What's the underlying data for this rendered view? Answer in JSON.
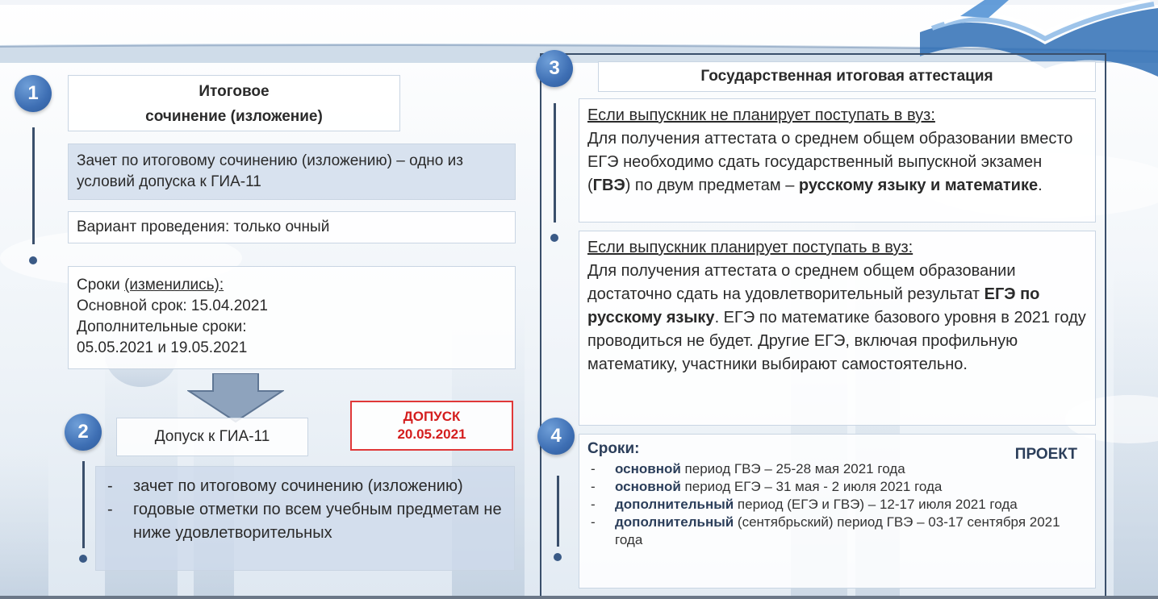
{
  "s1": {
    "num": "1",
    "title_l1": "Итоговое",
    "title_l2": "сочинение (изложение)",
    "zachet": "Зачет по итоговому сочинению (изложению) – одно из условий допуска к ГИА-11",
    "variant": "Вариант проведения: только очный",
    "sroki_label": "Сроки ",
    "sroki_changed": "(изменились):",
    "osnovnoy": "Основной срок: 15.04.2021",
    "dop_label": "Дополнительные сроки:",
    "dop_dates": "05.05.2021 и 19.05.2021"
  },
  "s2": {
    "num": "2",
    "title": "Допуск к ГИА-11",
    "dopusk_l1": "ДОПУСК",
    "dopusk_l2": "20.05.2021",
    "items": [
      "зачет по итоговому сочинению (изложению)",
      "годовые отметки по всем учебным предметам не ниже удовлетворительных"
    ]
  },
  "s3": {
    "num": "3",
    "title": "Государственная итоговая аттестация",
    "a_head": "Если выпускник не планирует поступать в вуз:",
    "a_t1": "Для получения аттестата о среднем общем образовании вместо ЕГЭ необходимо сдать государственный выпускной экзамен (",
    "a_b1": "ГВЭ",
    "a_t2": ") по двум предметам – ",
    "a_b2": "русскому языку и математике",
    "a_t3": ".",
    "b_head": "Если выпускник планирует поступать в вуз:",
    "b_t1": "Для получения аттестата о среднем общем образовании достаточно сдать на удовлетворительный результат ",
    "b_b1": "ЕГЭ по русскому языку",
    "b_t2": ". ЕГЭ по математике базового уровня в 2021 году проводиться не будет. Другие ЕГЭ, включая профильную математику, участники выбирают самостоятельно."
  },
  "s4": {
    "num": "4",
    "head": "Сроки:",
    "proekt": "ПРОЕКТ",
    "items": [
      {
        "bold": "основной",
        "text": " период ГВЭ – 25-28 мая 2021 года"
      },
      {
        "bold": "основной",
        "text": " период ЕГЭ – 31 мая - 2 июля 2021 года"
      },
      {
        "bold": "дополнительный",
        "text": " период (ЕГЭ и ГВЭ) – 12-17 июля 2021 года"
      },
      {
        "bold": "дополнительный",
        "text": " (сентябрьский) период ГВЭ – 03-17 сентября 2021 года"
      }
    ]
  }
}
